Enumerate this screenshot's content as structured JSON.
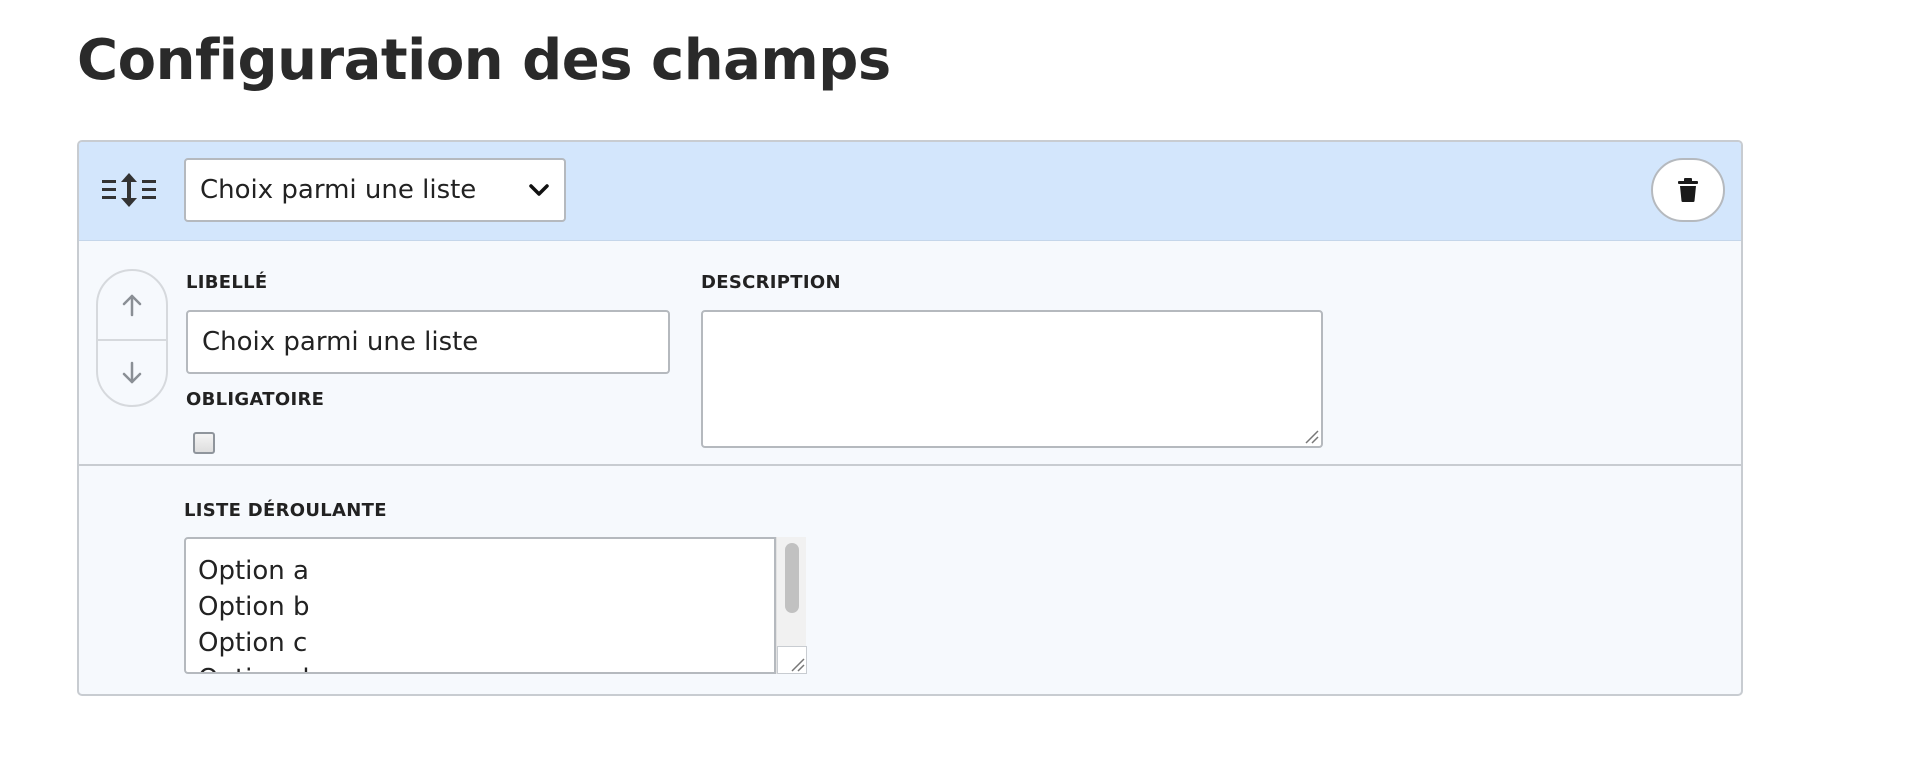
{
  "page": {
    "title": "Configuration des champs"
  },
  "field": {
    "type_select": {
      "value": "Choix parmi une liste"
    },
    "labels": {
      "libelle": "LIBELLÉ",
      "description": "DESCRIPTION",
      "obligatoire": "OBLIGATOIRE",
      "liste_deroulante": "LISTE DÉROULANTE"
    },
    "libelle_value": "Choix parmi une liste",
    "description_value": "",
    "obligatoire_checked": false,
    "options": [
      "Option a",
      "Option b",
      "Option c",
      "Option d"
    ]
  },
  "icons": {
    "drag": "reorder-drag-icon",
    "select": "chevron-down-icon",
    "delete": "trash-icon",
    "up": "arrow-up-icon",
    "down": "arrow-down-icon"
  },
  "colors": {
    "header_bg": "#d3e6fc",
    "card_bg": "#f6f9fd",
    "border": "#c8ccd1",
    "text": "#222222"
  }
}
